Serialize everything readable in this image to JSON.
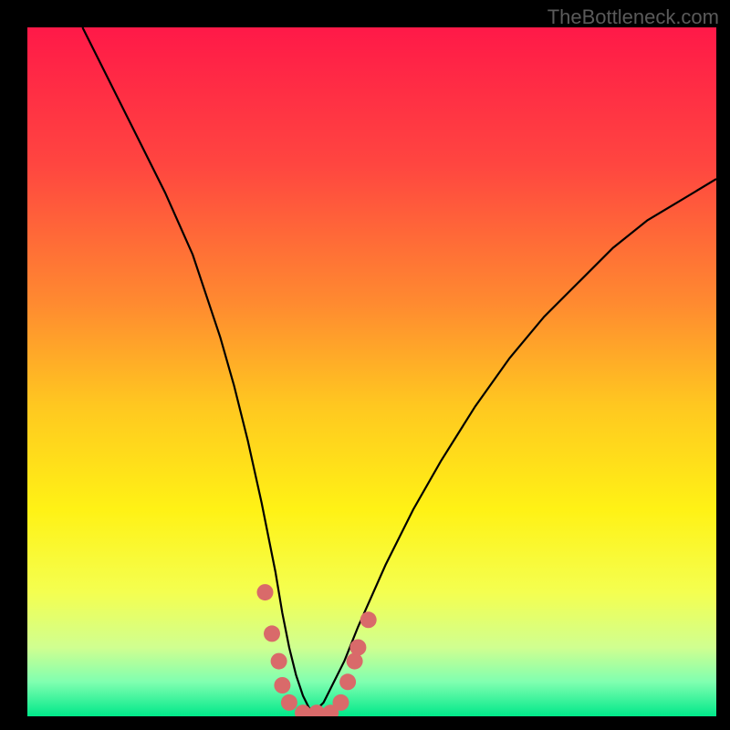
{
  "watermark": "TheBottleneck.com",
  "chart_data": {
    "type": "line",
    "title": "",
    "xlabel": "",
    "ylabel": "",
    "xlim": [
      0,
      100
    ],
    "ylim": [
      0,
      100
    ],
    "series": [
      {
        "name": "bottleneck-curve",
        "x": [
          8,
          12,
          16,
          20,
          24,
          28,
          30,
          32,
          34,
          36,
          37,
          38,
          39,
          40,
          41,
          42,
          43,
          44,
          46,
          48,
          52,
          56,
          60,
          65,
          70,
          75,
          80,
          85,
          90,
          95,
          100
        ],
        "y": [
          100,
          92,
          84,
          76,
          67,
          55,
          48,
          40,
          31,
          21,
          15,
          10,
          6,
          3,
          1,
          1,
          2,
          4,
          8,
          13,
          22,
          30,
          37,
          45,
          52,
          58,
          63,
          68,
          72,
          75,
          78
        ]
      }
    ],
    "markers": {
      "name": "highlighted-points",
      "color": "#d96a6a",
      "points": [
        {
          "x": 34.5,
          "y": 18
        },
        {
          "x": 35.5,
          "y": 12
        },
        {
          "x": 36.5,
          "y": 8
        },
        {
          "x": 37,
          "y": 4.5
        },
        {
          "x": 38,
          "y": 2
        },
        {
          "x": 40,
          "y": 0.5
        },
        {
          "x": 42,
          "y": 0.5
        },
        {
          "x": 44,
          "y": 0.5
        },
        {
          "x": 45.5,
          "y": 2
        },
        {
          "x": 46.5,
          "y": 5
        },
        {
          "x": 47.5,
          "y": 8
        },
        {
          "x": 48,
          "y": 10
        },
        {
          "x": 49.5,
          "y": 14
        }
      ]
    },
    "gradient_stops": [
      {
        "offset": 0,
        "color": "#ff1948"
      },
      {
        "offset": 20,
        "color": "#ff4640"
      },
      {
        "offset": 40,
        "color": "#ff8a30"
      },
      {
        "offset": 55,
        "color": "#ffc820"
      },
      {
        "offset": 70,
        "color": "#fff215"
      },
      {
        "offset": 82,
        "color": "#f4ff50"
      },
      {
        "offset": 90,
        "color": "#d0ff90"
      },
      {
        "offset": 95,
        "color": "#80ffb0"
      },
      {
        "offset": 100,
        "color": "#00e88a"
      }
    ]
  }
}
